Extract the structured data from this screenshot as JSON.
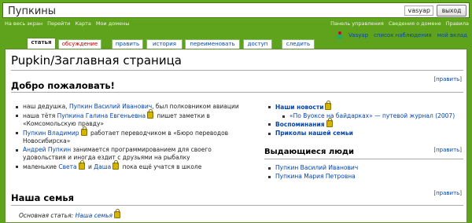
{
  "site": {
    "title": "Пупкины",
    "username": "vasyap",
    "exit_label": "выход"
  },
  "nav": {
    "left": [
      "На весь экран",
      "Перейти",
      "Карта",
      "Мои домены"
    ],
    "right": [
      "Панель управления",
      "Сведения о домене",
      "Правила"
    ]
  },
  "tabs": [
    "статья",
    "обсуждение",
    "править",
    "история",
    "переименовать",
    "доступ",
    "следить"
  ],
  "personal": [
    "Vasyap",
    "список наблюдения",
    "мой вклад"
  ],
  "page": {
    "title": "Pupkin/Заглавная страница",
    "edit_label": "править",
    "welcome": {
      "heading": "Добро пожаловать!",
      "items": [
        {
          "pre": "наш дедушка, ",
          "link": "Пупкин Василий Иванович",
          "post": ", был полковником авиации"
        },
        {
          "pre": "наша тётя ",
          "link": "Пупкина Галина Евгеньевна",
          "post": " пишет заметки в «Комсомольскую правду»"
        },
        {
          "pre": "",
          "link": "Пупкин Владимир",
          "post": " работает переводчиком в «Бюро переводов Новосибирска»"
        },
        {
          "pre": "",
          "link": "Андрей Пупкин",
          "post": " занимается программированием для своего удовольствия и иногда ездит с друзьями на рыбалку"
        },
        {
          "pre": "маленькие ",
          "link": "Света",
          "mid": " и ",
          "link2": "Даша",
          "post": " пока ещё учатся в школе"
        }
      ]
    },
    "news": {
      "title": "Наши новости",
      "sub_item": "«По Вуоксе на байдарках» — путевой журнал (2007)",
      "memories": "Воспоминания",
      "jokes": "Приколы нашей семьи"
    },
    "people": {
      "heading": "Выдающиеся люди",
      "items": [
        "Пупкин Василий Иванович",
        "Пупкина Мария Петровна"
      ]
    },
    "family": {
      "heading": "Наша семья",
      "main_label": "Основная статья:",
      "main_link": "Наша семья"
    }
  }
}
